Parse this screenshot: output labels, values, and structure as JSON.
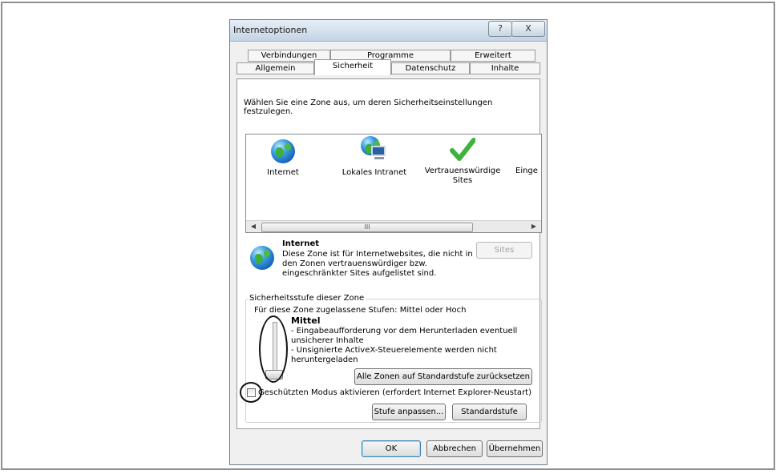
{
  "dialog": {
    "title": "Internetoptionen",
    "help_glyph": "?",
    "close_glyph": "X"
  },
  "tabs": {
    "row1": [
      "Verbindungen",
      "Programme",
      "Erweitert"
    ],
    "row2": [
      "Allgemein",
      "Sicherheit",
      "Datenschutz",
      "Inhalte"
    ],
    "active": "Sicherheit"
  },
  "security": {
    "zone_prompt": "Wählen Sie eine Zone aus, um deren Sicherheitseinstellungen festzulegen.",
    "zones": [
      {
        "label": "Internet",
        "icon": "globe-icon"
      },
      {
        "label": "Lokales Intranet",
        "icon": "intranet-icon"
      },
      {
        "label": "Vertrauenswürdige Sites",
        "icon": "checkmark-icon"
      },
      {
        "label": "Einge",
        "icon": "restricted-icon"
      }
    ],
    "scroll_thumb_glyph": "III",
    "selected_zone": {
      "name": "Internet",
      "description": "Diese Zone ist für Internetwebsites, die nicht in den Zonen vertrauenswürdiger bzw. eingeschränkter Sites aufgelistet sind.",
      "desc_lines": [
        "Diese Zone ist für Internetwebsites, die nicht in",
        "den Zonen vertrauenswürdiger bzw.",
        "eingeschränkter Sites aufgelistet sind."
      ],
      "sites_button": "Sites"
    },
    "level_group": {
      "legend": "Sicherheitsstufe dieser Zone",
      "allowed": "Für diese Zone zugelassene Stufen: Mittel oder Hoch",
      "level_name": "Mittel",
      "lines": [
        "- Eingabeaufforderung vor dem Herunterladen eventuell",
        "unsicherer Inhalte",
        "- Unsignierte ActiveX-Steuerelemente werden nicht",
        "heruntergeladen"
      ],
      "protected_mode_label": "Geschützten Modus aktivieren (erfordert Internet Explorer-Neustart)",
      "protected_mode_checked": false,
      "custom_level_button": "Stufe anpassen...",
      "default_level_button": "Standardstufe"
    },
    "reset_all_button": "Alle Zonen auf Standardstufe zurücksetzen"
  },
  "footer": {
    "ok": "OK",
    "cancel": "Abbrechen",
    "apply": "Übernehmen"
  }
}
